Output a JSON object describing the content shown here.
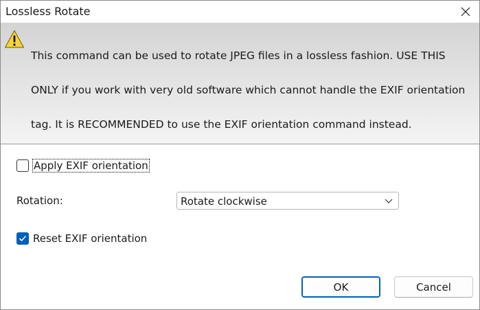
{
  "window": {
    "title": "Lossless Rotate",
    "close_icon": "close-icon"
  },
  "banner": {
    "icon": "warning-icon",
    "message_line1": "This command can be used to rotate JPEG files in a lossless fashion. USE THIS",
    "message_line2": "ONLY if you work with very old software which cannot handle the EXIF orientation",
    "message_line3": "tag. It is RECOMMENDED to use the EXIF orientation command instead."
  },
  "options": {
    "apply_exif": {
      "label": "Apply EXIF orientation",
      "checked": false
    },
    "rotation": {
      "label": "Rotation:",
      "selected": "Rotate clockwise"
    },
    "reset_exif": {
      "label": "Reset EXIF orientation",
      "checked": true
    }
  },
  "buttons": {
    "ok_label": "OK",
    "cancel_label": "Cancel"
  },
  "colors": {
    "accent": "#005fb8",
    "banner_top": "#d4d4d4",
    "banner_bottom": "#f4f4f4",
    "warning_fill": "#f5d33b"
  }
}
